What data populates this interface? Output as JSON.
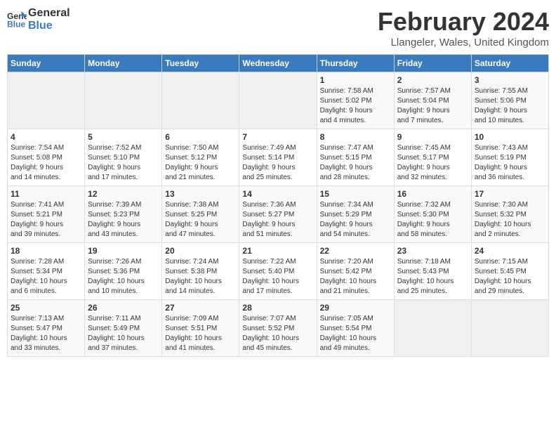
{
  "logo": {
    "general": "General",
    "blue": "Blue"
  },
  "title": "February 2024",
  "location": "Llangeler, Wales, United Kingdom",
  "headers": [
    "Sunday",
    "Monday",
    "Tuesday",
    "Wednesday",
    "Thursday",
    "Friday",
    "Saturday"
  ],
  "weeks": [
    [
      {
        "day": "",
        "info": ""
      },
      {
        "day": "",
        "info": ""
      },
      {
        "day": "",
        "info": ""
      },
      {
        "day": "",
        "info": ""
      },
      {
        "day": "1",
        "info": "Sunrise: 7:58 AM\nSunset: 5:02 PM\nDaylight: 9 hours\nand 4 minutes."
      },
      {
        "day": "2",
        "info": "Sunrise: 7:57 AM\nSunset: 5:04 PM\nDaylight: 9 hours\nand 7 minutes."
      },
      {
        "day": "3",
        "info": "Sunrise: 7:55 AM\nSunset: 5:06 PM\nDaylight: 9 hours\nand 10 minutes."
      }
    ],
    [
      {
        "day": "4",
        "info": "Sunrise: 7:54 AM\nSunset: 5:08 PM\nDaylight: 9 hours\nand 14 minutes."
      },
      {
        "day": "5",
        "info": "Sunrise: 7:52 AM\nSunset: 5:10 PM\nDaylight: 9 hours\nand 17 minutes."
      },
      {
        "day": "6",
        "info": "Sunrise: 7:50 AM\nSunset: 5:12 PM\nDaylight: 9 hours\nand 21 minutes."
      },
      {
        "day": "7",
        "info": "Sunrise: 7:49 AM\nSunset: 5:14 PM\nDaylight: 9 hours\nand 25 minutes."
      },
      {
        "day": "8",
        "info": "Sunrise: 7:47 AM\nSunset: 5:15 PM\nDaylight: 9 hours\nand 28 minutes."
      },
      {
        "day": "9",
        "info": "Sunrise: 7:45 AM\nSunset: 5:17 PM\nDaylight: 9 hours\nand 32 minutes."
      },
      {
        "day": "10",
        "info": "Sunrise: 7:43 AM\nSunset: 5:19 PM\nDaylight: 9 hours\nand 36 minutes."
      }
    ],
    [
      {
        "day": "11",
        "info": "Sunrise: 7:41 AM\nSunset: 5:21 PM\nDaylight: 9 hours\nand 39 minutes."
      },
      {
        "day": "12",
        "info": "Sunrise: 7:39 AM\nSunset: 5:23 PM\nDaylight: 9 hours\nand 43 minutes."
      },
      {
        "day": "13",
        "info": "Sunrise: 7:38 AM\nSunset: 5:25 PM\nDaylight: 9 hours\nand 47 minutes."
      },
      {
        "day": "14",
        "info": "Sunrise: 7:36 AM\nSunset: 5:27 PM\nDaylight: 9 hours\nand 51 minutes."
      },
      {
        "day": "15",
        "info": "Sunrise: 7:34 AM\nSunset: 5:29 PM\nDaylight: 9 hours\nand 54 minutes."
      },
      {
        "day": "16",
        "info": "Sunrise: 7:32 AM\nSunset: 5:30 PM\nDaylight: 9 hours\nand 58 minutes."
      },
      {
        "day": "17",
        "info": "Sunrise: 7:30 AM\nSunset: 5:32 PM\nDaylight: 10 hours\nand 2 minutes."
      }
    ],
    [
      {
        "day": "18",
        "info": "Sunrise: 7:28 AM\nSunset: 5:34 PM\nDaylight: 10 hours\nand 6 minutes."
      },
      {
        "day": "19",
        "info": "Sunrise: 7:26 AM\nSunset: 5:36 PM\nDaylight: 10 hours\nand 10 minutes."
      },
      {
        "day": "20",
        "info": "Sunrise: 7:24 AM\nSunset: 5:38 PM\nDaylight: 10 hours\nand 14 minutes."
      },
      {
        "day": "21",
        "info": "Sunrise: 7:22 AM\nSunset: 5:40 PM\nDaylight: 10 hours\nand 17 minutes."
      },
      {
        "day": "22",
        "info": "Sunrise: 7:20 AM\nSunset: 5:42 PM\nDaylight: 10 hours\nand 21 minutes."
      },
      {
        "day": "23",
        "info": "Sunrise: 7:18 AM\nSunset: 5:43 PM\nDaylight: 10 hours\nand 25 minutes."
      },
      {
        "day": "24",
        "info": "Sunrise: 7:15 AM\nSunset: 5:45 PM\nDaylight: 10 hours\nand 29 minutes."
      }
    ],
    [
      {
        "day": "25",
        "info": "Sunrise: 7:13 AM\nSunset: 5:47 PM\nDaylight: 10 hours\nand 33 minutes."
      },
      {
        "day": "26",
        "info": "Sunrise: 7:11 AM\nSunset: 5:49 PM\nDaylight: 10 hours\nand 37 minutes."
      },
      {
        "day": "27",
        "info": "Sunrise: 7:09 AM\nSunset: 5:51 PM\nDaylight: 10 hours\nand 41 minutes."
      },
      {
        "day": "28",
        "info": "Sunrise: 7:07 AM\nSunset: 5:52 PM\nDaylight: 10 hours\nand 45 minutes."
      },
      {
        "day": "29",
        "info": "Sunrise: 7:05 AM\nSunset: 5:54 PM\nDaylight: 10 hours\nand 49 minutes."
      },
      {
        "day": "",
        "info": ""
      },
      {
        "day": "",
        "info": ""
      }
    ]
  ]
}
